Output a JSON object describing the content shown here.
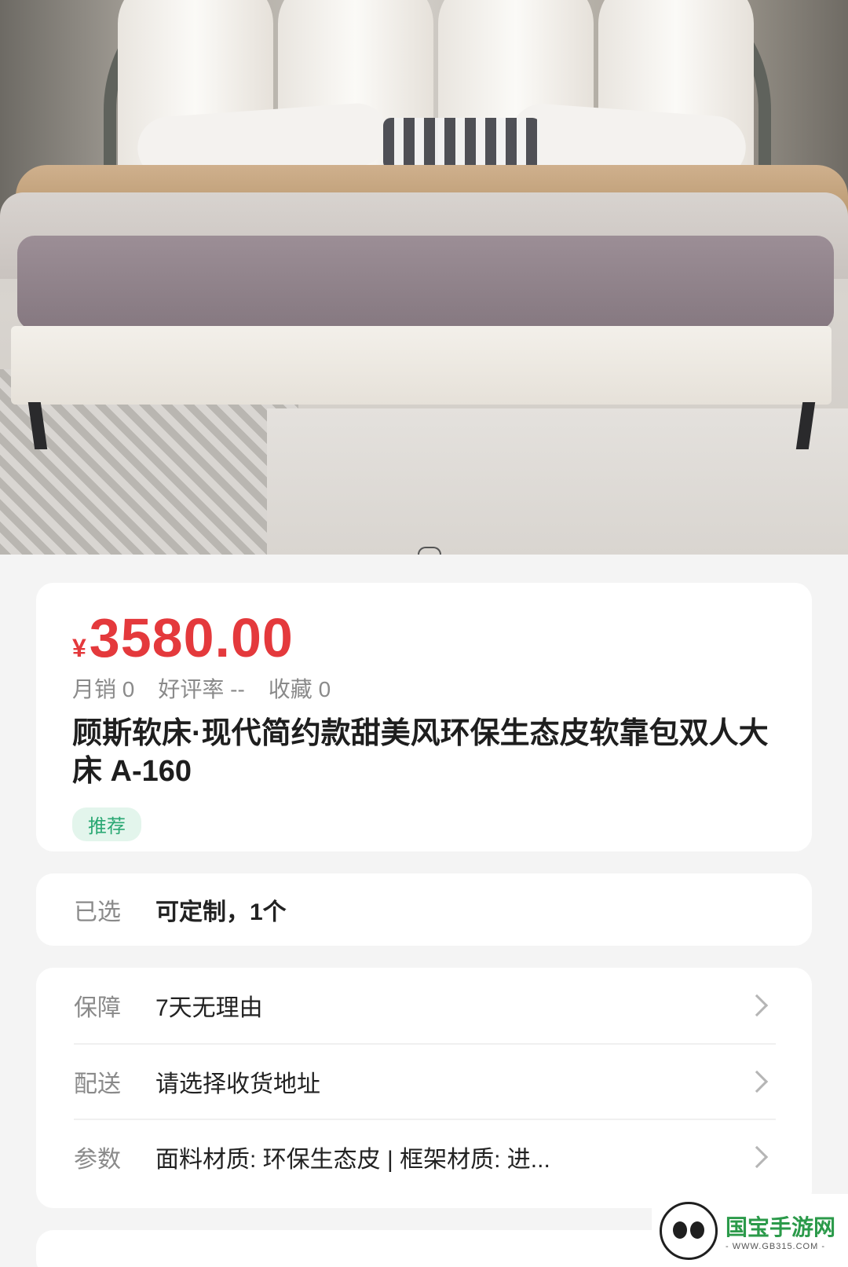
{
  "product": {
    "currency": "¥",
    "price": "3580.00",
    "stats": {
      "monthly_sales": "月销 0",
      "rating": "好评率 --",
      "favorites": "收藏 0"
    },
    "title": "顾斯软床·现代简约款甜美风环保生态皮软靠包双人大床 A-160",
    "tag": "推荐"
  },
  "selection": {
    "label": "已选",
    "value": "可定制，1个"
  },
  "info": [
    {
      "label": "保障",
      "value": "7天无理由"
    },
    {
      "label": "配送",
      "value": "请选择收货地址"
    },
    {
      "label": "参数",
      "value": "面料材质: 环保生态皮 | 框架材质: 进..."
    }
  ],
  "watermark": {
    "name": "国宝手游网",
    "site": "- WWW.GB315.COM -"
  },
  "colors": {
    "price": "#e4393c",
    "tag_bg": "#e3f5ec",
    "tag_text": "#2aa873"
  }
}
